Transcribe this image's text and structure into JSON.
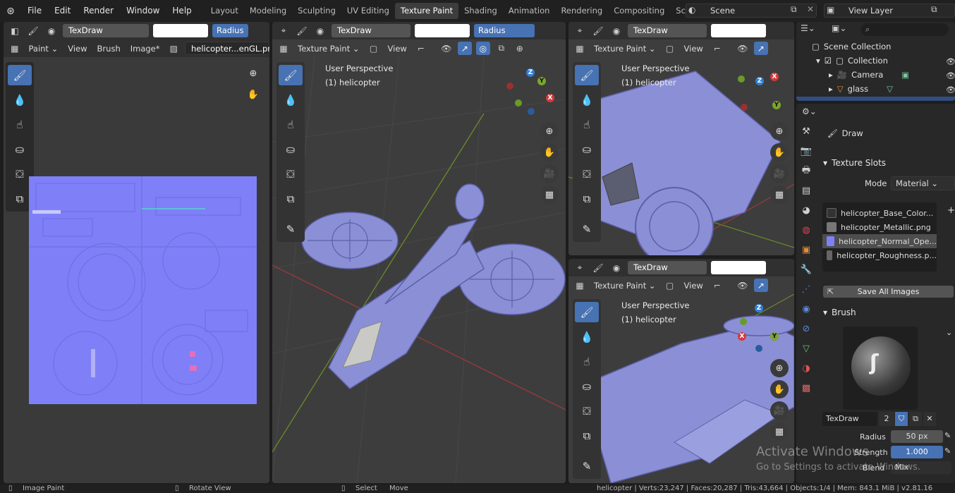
{
  "topbar": {
    "menus": [
      "File",
      "Edit",
      "Render",
      "Window",
      "Help"
    ],
    "workspaces": [
      "Layout",
      "Modeling",
      "Sculpting",
      "UV Editing",
      "Texture Paint",
      "Shading",
      "Animation",
      "Rendering",
      "Compositing",
      "Scripting"
    ],
    "active_workspace": "Texture Paint",
    "scene": "Scene",
    "view_layer": "View Layer"
  },
  "image_editor": {
    "brush": "TexDraw",
    "radius_label": "Radius",
    "mode": "Paint",
    "menus": [
      "View",
      "Brush",
      "Image*"
    ],
    "image_name": "helicopter...enGL.png"
  },
  "viewport_main": {
    "brush": "TexDraw",
    "radius_label": "Radius",
    "mode": "Texture Paint",
    "view_menu": "View",
    "title": "User Perspective",
    "object": "(1) helicopter"
  },
  "viewport_top_right": {
    "brush": "TexDraw",
    "mode": "Texture Paint",
    "view_menu": "View",
    "title": "User Perspective",
    "object": "(1) helicopter"
  },
  "viewport_bottom_right": {
    "brush": "TexDraw",
    "mode": "Texture Paint",
    "view_menu": "View",
    "title": "User Perspective",
    "object": "(1) helicopter"
  },
  "outliner": {
    "root": "Scene Collection",
    "items": [
      "Collection",
      "Camera",
      "glass"
    ]
  },
  "properties": {
    "tool_name": "Draw",
    "texture_slots_title": "Texture Slots",
    "mode_label": "Mode",
    "mode_value": "Material",
    "slots": [
      "helicopter_Base_Color...",
      "helicopter_Metallic.png",
      "helicopter_Normal_Ope...",
      "helicopter_Roughness.p..."
    ],
    "selected_slot": 2,
    "save_all": "Save All Images",
    "brush_title": "Brush",
    "brush_name": "TexDraw",
    "brush_users": "2",
    "radius_label": "Radius",
    "radius_value": "50 px",
    "strength_label": "Strength",
    "strength_value": "1.000",
    "blend_label": "Blend",
    "blend_value": "Mix"
  },
  "status": {
    "left": "Image Paint",
    "mid1": "Rotate View",
    "mid2": "Select",
    "mid3": "Move",
    "right": "helicopter | Verts:23,247 | Faces:20,287 | Tris:43,664 | Objects:1/4 | Mem: 843.1 MiB | v2.81.16"
  },
  "watermark": {
    "line1": "Activate Windows",
    "line2": "Go to Settings to activate Windows."
  },
  "colors": {
    "accent": "#4772b3",
    "normal_map": "#7f80f8",
    "model": "#8a8fd6"
  }
}
